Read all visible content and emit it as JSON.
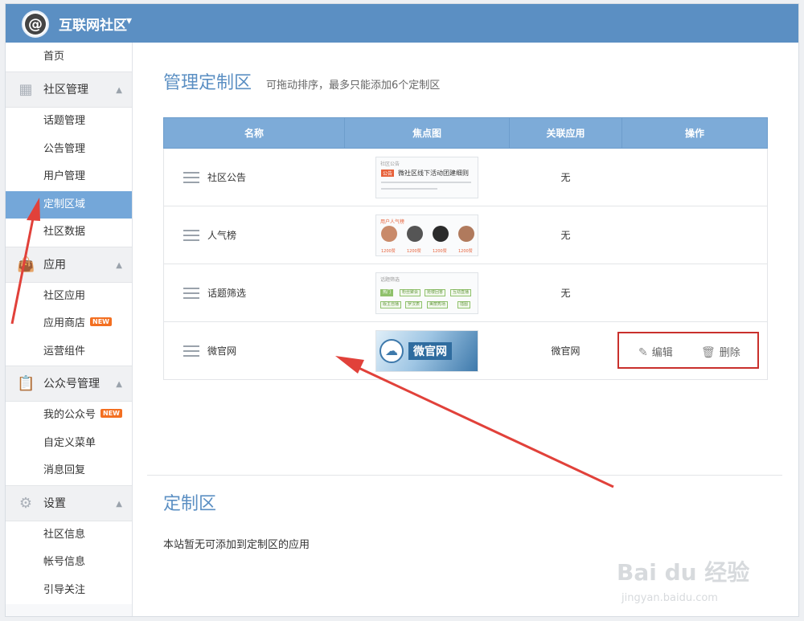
{
  "app": {
    "title": "互联网社区"
  },
  "sidebar": {
    "home": "首页",
    "groups": [
      {
        "label": "社区管理",
        "icon": "grid-icon",
        "items": [
          {
            "label": "话题管理"
          },
          {
            "label": "公告管理"
          },
          {
            "label": "用户管理"
          },
          {
            "label": "定制区域",
            "active": true
          },
          {
            "label": "社区数据"
          }
        ]
      },
      {
        "label": "应用",
        "icon": "bag-icon",
        "items": [
          {
            "label": "社区应用"
          },
          {
            "label": "应用商店",
            "badge": "NEW"
          },
          {
            "label": "运营组件"
          }
        ]
      },
      {
        "label": "公众号管理",
        "icon": "clipboard-check-icon",
        "items": [
          {
            "label": "我的公众号",
            "badge": "NEW"
          },
          {
            "label": "自定义菜单"
          },
          {
            "label": "消息回复"
          }
        ]
      },
      {
        "label": "设置",
        "icon": "gear-icon",
        "items": [
          {
            "label": "社区信息"
          },
          {
            "label": "帐号信息"
          },
          {
            "label": "引导关注"
          }
        ]
      }
    ]
  },
  "main": {
    "section_title": "管理定制区",
    "section_subtitle": "可拖动排序，最多只能添加6个定制区",
    "table": {
      "headers": [
        "名称",
        "焦点图",
        "关联应用",
        "操作"
      ],
      "rows": [
        {
          "name": "社区公告",
          "app": "无",
          "thumb": {
            "header": "社区公告",
            "badge": "公告",
            "text": "微社区线下活动团建细则"
          }
        },
        {
          "name": "人气榜",
          "app": "无",
          "thumb": {
            "header": "用户人气榜",
            "counts": [
              "1200赞",
              "1200赞",
              "1200赞",
              "1200赞"
            ]
          }
        },
        {
          "name": "话题筛选",
          "app": "无",
          "thumb": {
            "header": "话题筛选",
            "tags": [
              "热门",
              "粉丝聚会",
              "抢楼回答",
              "互动直播",
              "版主自播",
              "罗汉表",
              "美丽秀场",
              "插图"
            ]
          }
        },
        {
          "name": "微官网",
          "app": "微官网",
          "thumb": {
            "label": "微官网"
          }
        }
      ],
      "ops": {
        "edit": "编辑",
        "delete": "删除"
      }
    },
    "section2_title": "定制区",
    "section2_text": "本站暂无可添加到定制区的应用"
  },
  "watermark": {
    "brand": "Bai du 经验",
    "url": "jingyan.baidu.com"
  },
  "colors": {
    "topbar": "#5b8fc3",
    "active": "#74a7d9",
    "header": "#7dabd8",
    "highlight": "#c9302c",
    "arrow": "#e1413a"
  }
}
